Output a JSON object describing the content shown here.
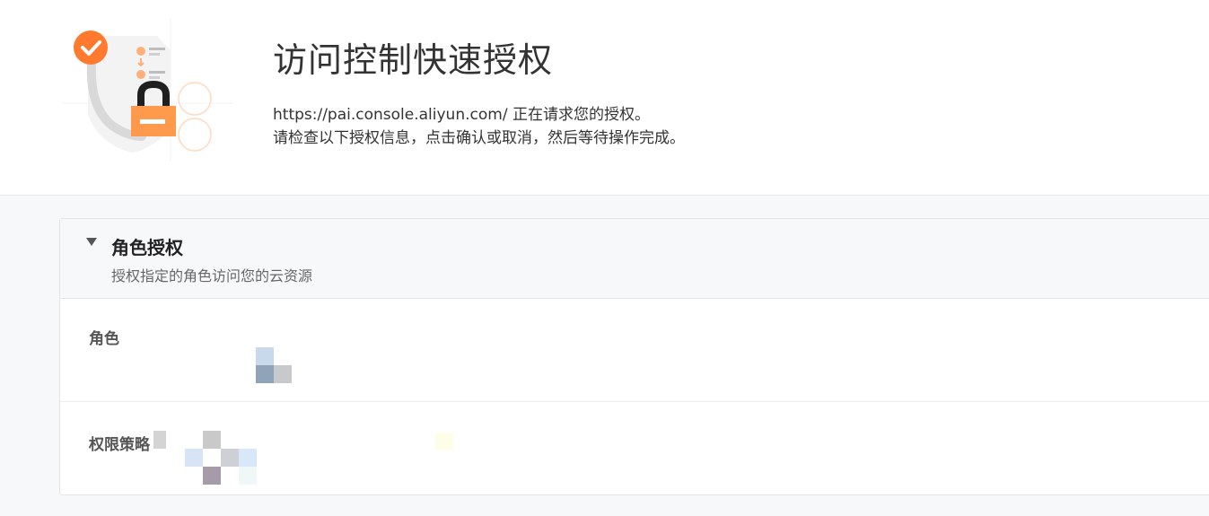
{
  "header": {
    "title": "访问控制快速授权",
    "description_line1": "https://pai.console.aliyun.com/ 正在请求您的授权。",
    "description_line2": "请检查以下授权信息，点击确认或取消，然后等待操作完成。",
    "illustration": "shield-lock-checklist-illustration",
    "accent_color": "#ff8a3d"
  },
  "panel": {
    "title": "角色授权",
    "subtitle": "授权指定的角色访问您的云资源",
    "caret_icon": "caret-down-icon",
    "rows": [
      {
        "label": "角色",
        "value_state": "pixelated"
      },
      {
        "label": "权限策略",
        "value_state": "pixelated"
      }
    ]
  }
}
